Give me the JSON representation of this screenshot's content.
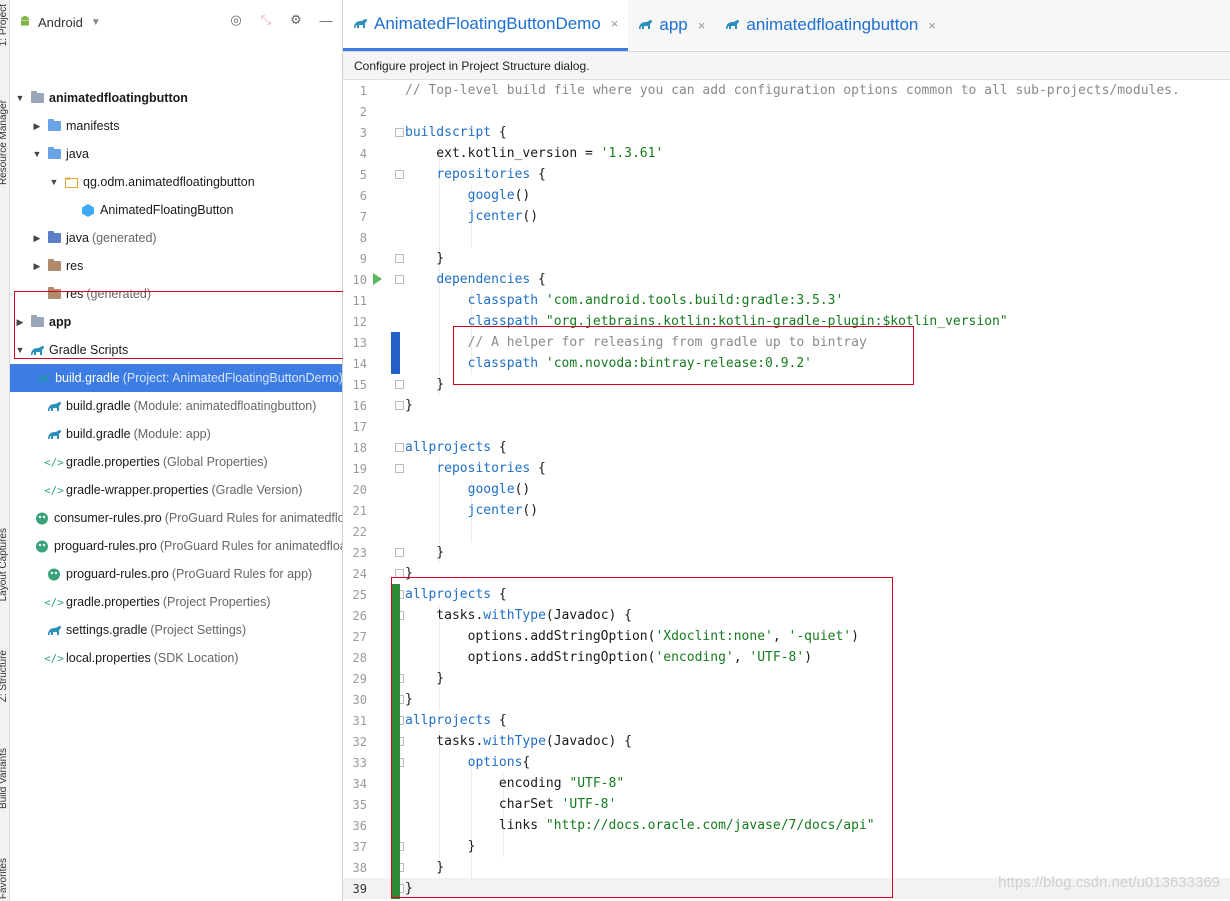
{
  "project_panel": {
    "view_mode": "Android",
    "tree": [
      {
        "label": "animatedfloatingbutton",
        "extra": "",
        "icon": "module-folder-icon",
        "depth": 0,
        "arrow": "down",
        "bold": true
      },
      {
        "label": "manifests",
        "extra": "",
        "icon": "folder-icon",
        "depth": 1,
        "arrow": "right"
      },
      {
        "label": "java",
        "extra": "",
        "icon": "folder-icon",
        "depth": 1,
        "arrow": "down"
      },
      {
        "label": "qg.odm.animatedfloatingbutton",
        "extra": "",
        "icon": "package-icon",
        "depth": 2,
        "arrow": "down"
      },
      {
        "label": "AnimatedFloatingButton",
        "extra": "",
        "icon": "kotlin-class-icon",
        "depth": 3,
        "arrow": ""
      },
      {
        "label": "java",
        "extra": "(generated)",
        "icon": "folder-generated-icon",
        "depth": 1,
        "arrow": "right"
      },
      {
        "label": "res",
        "extra": "",
        "icon": "res-folder-icon",
        "depth": 1,
        "arrow": "right"
      },
      {
        "label": "res",
        "extra": "(generated)",
        "icon": "res-folder-icon",
        "depth": 1,
        "arrow": ""
      },
      {
        "label": "app",
        "extra": "",
        "icon": "module-folder-icon",
        "depth": 0,
        "arrow": "right",
        "bold": true
      },
      {
        "label": "Gradle Scripts",
        "extra": "",
        "icon": "gradle-icon",
        "depth": 0,
        "arrow": "down"
      },
      {
        "label": "build.gradle",
        "extra": "(Project: AnimatedFloatingButtonDemo)",
        "icon": "gradle-icon",
        "depth": 1,
        "arrow": "",
        "selected": true
      },
      {
        "label": "build.gradle",
        "extra": "(Module: animatedfloatingbutton)",
        "icon": "gradle-icon",
        "depth": 1,
        "arrow": ""
      },
      {
        "label": "build.gradle",
        "extra": "(Module: app)",
        "icon": "gradle-icon",
        "depth": 1,
        "arrow": ""
      },
      {
        "label": "gradle.properties",
        "extra": "(Global Properties)",
        "icon": "properties-icon",
        "depth": 1,
        "arrow": ""
      },
      {
        "label": "gradle-wrapper.properties",
        "extra": "(Gradle Version)",
        "icon": "properties-icon",
        "depth": 1,
        "arrow": ""
      },
      {
        "label": "consumer-rules.pro",
        "extra": "(ProGuard Rules for animatedfloa",
        "icon": "proguard-icon",
        "depth": 1,
        "arrow": ""
      },
      {
        "label": "proguard-rules.pro",
        "extra": "(ProGuard Rules for animatedfloa",
        "icon": "proguard-icon",
        "depth": 1,
        "arrow": ""
      },
      {
        "label": "proguard-rules.pro",
        "extra": "(ProGuard Rules for app)",
        "icon": "proguard-icon",
        "depth": 1,
        "arrow": ""
      },
      {
        "label": "gradle.properties",
        "extra": "(Project Properties)",
        "icon": "properties-icon",
        "depth": 1,
        "arrow": ""
      },
      {
        "label": "settings.gradle",
        "extra": "(Project Settings)",
        "icon": "gradle-icon",
        "depth": 1,
        "arrow": ""
      },
      {
        "label": "local.properties",
        "extra": "(SDK Location)",
        "icon": "properties-icon",
        "depth": 1,
        "arrow": ""
      }
    ]
  },
  "side_strip": {
    "labels": [
      "1: Project",
      "Resource Manager",
      "Layout Captures",
      "Z: Structure",
      "Build Variants",
      "Favorites"
    ]
  },
  "editor": {
    "tabs": [
      {
        "label": "AnimatedFloatingButtonDemo",
        "active": true
      },
      {
        "label": "app",
        "active": false
      },
      {
        "label": "animatedfloatingbutton",
        "active": false
      }
    ],
    "notice": "Configure project in Project Structure dialog.",
    "current_line": 39,
    "lines": [
      [
        [
          "// Top-level build file where you can add configuration options common to all sub-projects/modules.",
          "cmt"
        ]
      ],
      [],
      [
        [
          "buildscript",
          "kw"
        ],
        [
          " {",
          ""
        ]
      ],
      [
        [
          "    ext.kotlin_version = ",
          ""
        ],
        [
          "'1.3.61'",
          "str"
        ]
      ],
      [
        [
          "    ",
          ""
        ],
        [
          "repositories",
          "kw"
        ],
        [
          " {",
          ""
        ]
      ],
      [
        [
          "        ",
          ""
        ],
        [
          "google",
          "kw"
        ],
        [
          "()",
          ""
        ]
      ],
      [
        [
          "        ",
          ""
        ],
        [
          "jcenter",
          "kw"
        ],
        [
          "()",
          ""
        ]
      ],
      [],
      [
        [
          "    }",
          ""
        ]
      ],
      [
        [
          "    ",
          ""
        ],
        [
          "dependencies",
          "kw"
        ],
        [
          " {",
          ""
        ]
      ],
      [
        [
          "        ",
          ""
        ],
        [
          "classpath",
          "kw"
        ],
        [
          " ",
          ""
        ],
        [
          "'com.android.tools.build:gradle:3.5.3'",
          "str"
        ]
      ],
      [
        [
          "        ",
          ""
        ],
        [
          "classpath",
          "kw"
        ],
        [
          " ",
          ""
        ],
        [
          "\"org.jetbrains.kotlin:kotlin-gradle-plugin:$kotlin_version\"",
          "str"
        ]
      ],
      [
        [
          "        // A helper for releasing from gradle up to bintray",
          "cmt"
        ]
      ],
      [
        [
          "        ",
          ""
        ],
        [
          "classpath",
          "kw"
        ],
        [
          " ",
          ""
        ],
        [
          "'com.novoda:bintray-release:0.9.2'",
          "str"
        ]
      ],
      [
        [
          "    }",
          ""
        ]
      ],
      [
        [
          "}",
          ""
        ]
      ],
      [],
      [
        [
          "allprojects",
          "kw"
        ],
        [
          " {",
          ""
        ]
      ],
      [
        [
          "    ",
          ""
        ],
        [
          "repositories",
          "kw"
        ],
        [
          " {",
          ""
        ]
      ],
      [
        [
          "        ",
          ""
        ],
        [
          "google",
          "kw"
        ],
        [
          "()",
          ""
        ]
      ],
      [
        [
          "        ",
          ""
        ],
        [
          "jcenter",
          "kw"
        ],
        [
          "()",
          ""
        ]
      ],
      [],
      [
        [
          "    }",
          ""
        ]
      ],
      [
        [
          "}",
          ""
        ]
      ],
      [
        [
          "allprojects",
          "kw"
        ],
        [
          " {",
          ""
        ]
      ],
      [
        [
          "    tasks.",
          ""
        ],
        [
          "withType",
          "kw"
        ],
        [
          "(Javadoc) {",
          ""
        ]
      ],
      [
        [
          "        options.addStringOption(",
          ""
        ],
        [
          "'Xdoclint:none'",
          "str"
        ],
        [
          ", ",
          ""
        ],
        [
          "'-quiet'",
          "str"
        ],
        [
          ")",
          ""
        ]
      ],
      [
        [
          "        options.addStringOption(",
          ""
        ],
        [
          "'encoding'",
          "str"
        ],
        [
          ", ",
          ""
        ],
        [
          "'UTF-8'",
          "str"
        ],
        [
          ")",
          ""
        ]
      ],
      [
        [
          "    }",
          ""
        ]
      ],
      [
        [
          "}",
          ""
        ]
      ],
      [
        [
          "allprojects",
          "kw"
        ],
        [
          " {",
          ""
        ]
      ],
      [
        [
          "    tasks.",
          ""
        ],
        [
          "withType",
          "kw"
        ],
        [
          "(Javadoc) {",
          ""
        ]
      ],
      [
        [
          "        ",
          ""
        ],
        [
          "options",
          "kw"
        ],
        [
          "{",
          ""
        ]
      ],
      [
        [
          "            encoding ",
          ""
        ],
        [
          "\"UTF-8\"",
          "str"
        ]
      ],
      [
        [
          "            charSet ",
          ""
        ],
        [
          "'UTF-8'",
          "str"
        ]
      ],
      [
        [
          "            links ",
          ""
        ],
        [
          "\"http://docs.oracle.com/javase/7/docs/api\"",
          "str"
        ]
      ],
      [
        [
          "        }",
          ""
        ]
      ],
      [
        [
          "    }",
          ""
        ]
      ],
      [
        [
          "}",
          ""
        ]
      ]
    ]
  },
  "watermark": "https://blog.csdn.net/u013633369",
  "colors": {
    "accent": "#3d7ce2",
    "keyword": "#1f6fc5",
    "string": "#167a1f",
    "comment": "#8a8a8a",
    "highlight_box": "#d6001c",
    "vcs_added": "#2e8b3a",
    "vcs_modified": "#2260c8"
  }
}
